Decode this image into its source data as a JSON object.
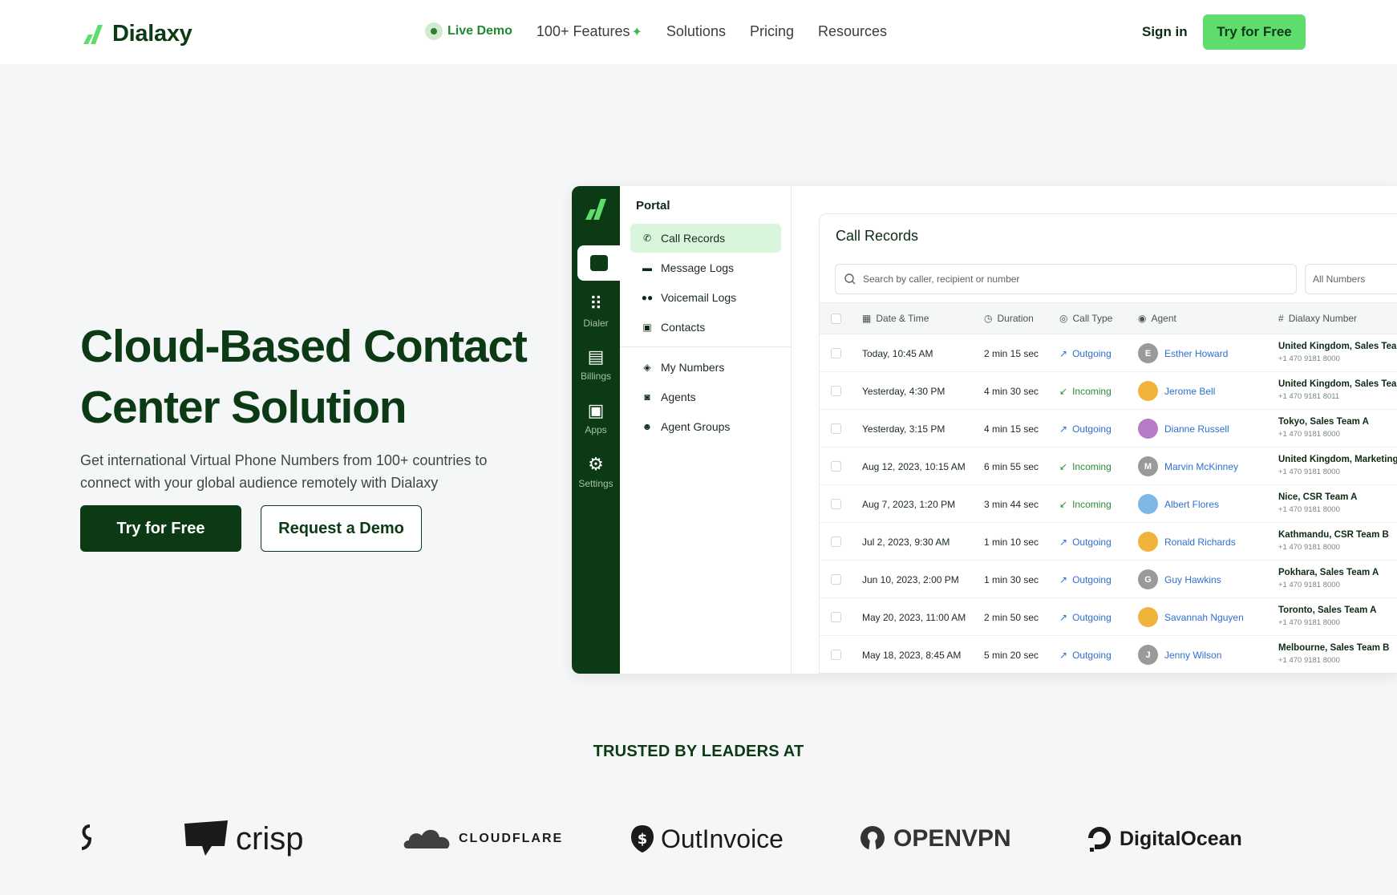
{
  "nav": {
    "brand": "Dialaxy",
    "live_demo": "Live Demo",
    "features": "100+ Features",
    "solutions": "Solutions",
    "pricing": "Pricing",
    "resources": "Resources",
    "sign_in": "Sign in",
    "try_free": "Try for Free"
  },
  "hero": {
    "title_line1": "Cloud-Based Contact",
    "title_line2": "Center Solution",
    "subtitle_line1": "Get international Virtual Phone Numbers from 100+ countries to",
    "subtitle_line2": "connect with your global audience remotely with Dialaxy",
    "primary_cta": "Try for Free",
    "secondary_cta": "Request a Demo"
  },
  "app": {
    "rail": [
      {
        "label": "Dialer",
        "icon": "dialpad-icon"
      },
      {
        "label": "Billings",
        "icon": "billing-icon"
      },
      {
        "label": "Apps",
        "icon": "apps-icon"
      },
      {
        "label": "Settings",
        "icon": "gear-icon"
      }
    ],
    "portal_title": "Portal",
    "portal_items": [
      {
        "label": "Call Records",
        "icon": "phone-icon"
      },
      {
        "label": "Message Logs",
        "icon": "message-icon"
      },
      {
        "label": "Voicemail Logs",
        "icon": "voicemail-icon"
      },
      {
        "label": "Contacts",
        "icon": "contacts-icon"
      },
      {
        "label": "My Numbers",
        "icon": "box-icon"
      },
      {
        "label": "Agents",
        "icon": "agent-icon"
      },
      {
        "label": "Agent Groups",
        "icon": "group-icon"
      }
    ],
    "panel_title": "Call Records",
    "search_placeholder": "Search by caller, recipient or number",
    "filter": "All Numbers",
    "columns": {
      "date": "Date & Time",
      "duration": "Duration",
      "type": "Call Type",
      "agent": "Agent",
      "number": "Dialaxy Number"
    },
    "rows": [
      {
        "date": "Today, 10:45 AM",
        "duration": "2 min 15 sec",
        "type": "Outgoing",
        "agent": "Esther Howard",
        "initial": "E",
        "avatar": "#9a9a9a",
        "team": "United Kingdom, Sales Team",
        "phone": "+1 470 9181 8000"
      },
      {
        "date": "Yesterday, 4:30 PM",
        "duration": "4 min 30 sec",
        "type": "Incoming",
        "agent": "Jerome Bell",
        "initial": "",
        "avatar": "#f0b43c",
        "team": "United Kingdom, Sales Team",
        "phone": "+1 470 9181 8011"
      },
      {
        "date": "Yesterday, 3:15 PM",
        "duration": "4 min 15 sec",
        "type": "Outgoing",
        "agent": "Dianne Russell",
        "initial": "",
        "avatar": "#b77bc7",
        "team": "Tokyo, Sales Team A",
        "phone": "+1 470 9181 8000"
      },
      {
        "date": "Aug 12, 2023, 10:15 AM",
        "duration": "6 min 55 sec",
        "type": "Incoming",
        "agent": "Marvin McKinney",
        "initial": "M",
        "avatar": "#9a9a9a",
        "team": "United Kingdom, Marketing",
        "phone": "+1 470 9181 8000"
      },
      {
        "date": "Aug 7, 2023, 1:20 PM",
        "duration": "3 min 44 sec",
        "type": "Incoming",
        "agent": "Albert Flores",
        "initial": "",
        "avatar": "#7fb7e6",
        "team": "Nice, CSR Team A",
        "phone": "+1 470 9181 8000"
      },
      {
        "date": "Jul 2, 2023, 9:30 AM",
        "duration": "1 min 10 sec",
        "type": "Outgoing",
        "agent": "Ronald Richards",
        "initial": "",
        "avatar": "#f0b43c",
        "team": "Kathmandu, CSR Team B",
        "phone": "+1 470 9181 8000"
      },
      {
        "date": "Jun 10, 2023, 2:00 PM",
        "duration": "1 min 30 sec",
        "type": "Outgoing",
        "agent": "Guy Hawkins",
        "initial": "G",
        "avatar": "#9a9a9a",
        "team": "Pokhara, Sales Team A",
        "phone": "+1 470 9181 8000"
      },
      {
        "date": "May 20, 2023, 11:00 AM",
        "duration": "2 min 50 sec",
        "type": "Outgoing",
        "agent": "Savannah Nguyen",
        "initial": "",
        "avatar": "#f0b43c",
        "team": "Toronto, Sales Team A",
        "phone": "+1 470 9181 8000"
      },
      {
        "date": "May 18, 2023, 8:45 AM",
        "duration": "5 min 20 sec",
        "type": "Outgoing",
        "agent": "Jenny Wilson",
        "initial": "J",
        "avatar": "#9a9a9a",
        "team": "Melbourne, Sales Team B",
        "phone": "+1 470 9181 8000"
      }
    ]
  },
  "trusted": {
    "heading": "TRUSTED BY LEADERS AT",
    "logos": [
      "crisp",
      "CLOUDFLARE",
      "OutInvoice",
      "OPENVPN",
      "DigitalOcean"
    ]
  },
  "colors": {
    "brand_dark": "#0b3a14",
    "brand_green": "#5fdd6c",
    "link_blue": "#2f6fcf",
    "incoming_green": "#2b8a3b"
  }
}
